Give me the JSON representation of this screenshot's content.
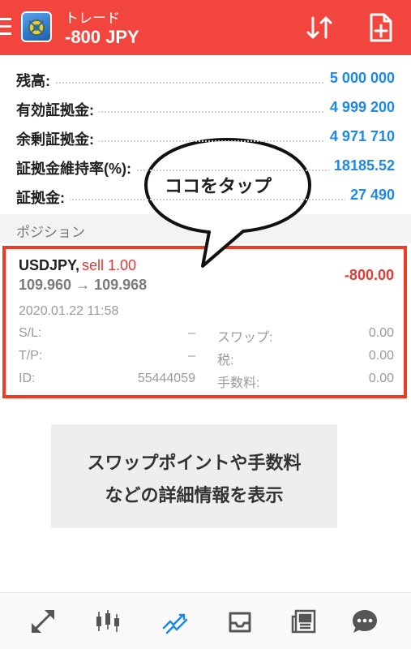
{
  "header": {
    "title": "トレード",
    "subtitle": "-800 JPY",
    "bg_color": "#f2453d",
    "icons": [
      "menu-icon",
      "app-logo-icon",
      "sort-icon",
      "add-document-icon"
    ]
  },
  "account": {
    "rows": [
      {
        "label": "残高:",
        "value": "5 000 000"
      },
      {
        "label": "有効証拠金:",
        "value": "4 999 200"
      },
      {
        "label": "余剰証拠金:",
        "value": "4 971 710"
      },
      {
        "label": "証拠金維持率(%):",
        "value": "18185.52"
      },
      {
        "label": "証拠金:",
        "value": "27 490"
      }
    ],
    "value_color": "#1e88e5"
  },
  "positions": {
    "section_title": "ポジション",
    "items": [
      {
        "symbol": "USDJPY,",
        "side": "sell 1.00",
        "prices": "109.960 → 109.968",
        "profit": "-800.00",
        "time": "2020.01.22 11:58",
        "sl_label": "S/L:",
        "sl_value": "–",
        "swap_label": "スワップ:",
        "swap_value": "0.00",
        "tp_label": "T/P:",
        "tp_value": "–",
        "tax_label": "税:",
        "tax_value": "0.00",
        "id_label": "ID:",
        "id_value": "55444059",
        "fee_label": "手数料:",
        "fee_value": "0.00"
      }
    ],
    "highlight_color": "#f23a23"
  },
  "callout": {
    "text": "ココをタップ"
  },
  "info_box": {
    "line1": "スワップポイントや手数料",
    "line2": "などの詳細情報を表示"
  },
  "bottom_nav": {
    "items": [
      "quotes-icon",
      "chart-icon",
      "trade-icon",
      "history-icon",
      "news-icon",
      "chat-icon"
    ],
    "active_index": 2,
    "active_color": "#1e88e5"
  }
}
